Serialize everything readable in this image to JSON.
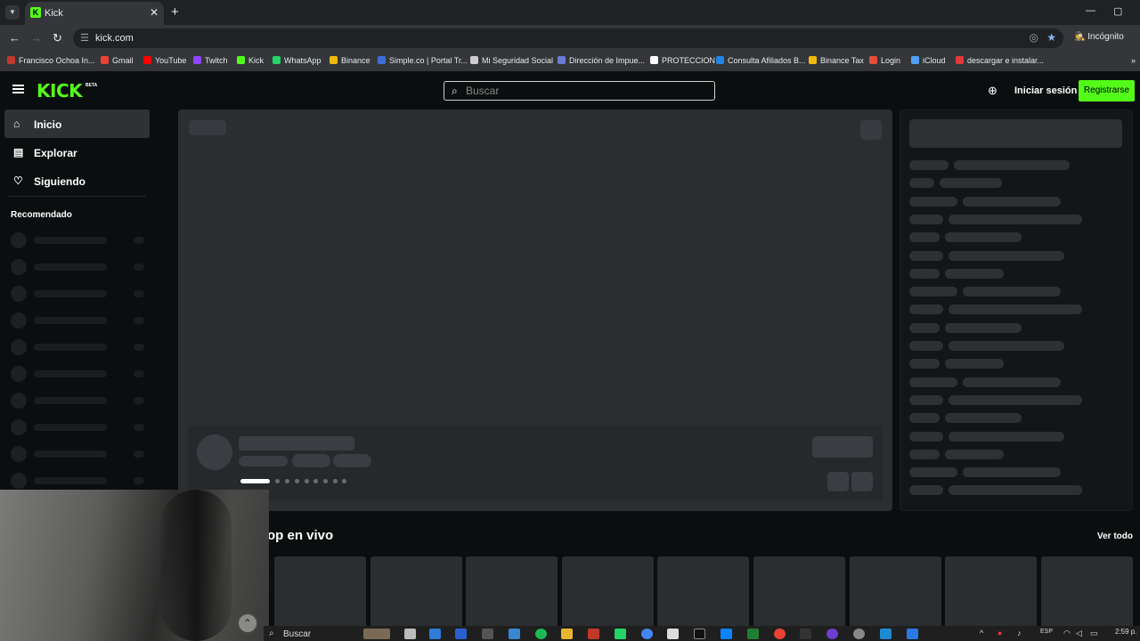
{
  "browser": {
    "tab_title": "Kick",
    "url": "kick.com",
    "incognito_label": "Incógnito",
    "bookmarks": [
      {
        "label": "Francisco Ochoa In...",
        "color": "#c0392b"
      },
      {
        "label": "Gmail",
        "color": "#ea4335"
      },
      {
        "label": "YouTube",
        "color": "#ff0000"
      },
      {
        "label": "Twitch",
        "color": "#9146ff"
      },
      {
        "label": "Kick",
        "color": "#53fc18"
      },
      {
        "label": "WhatsApp",
        "color": "#25d366"
      },
      {
        "label": "Binance",
        "color": "#f0b90b"
      },
      {
        "label": "Simple.co | Portal Tr...",
        "color": "#3b6fd6"
      },
      {
        "label": "Mi Seguridad Social",
        "color": "#cccccc"
      },
      {
        "label": "Dirección de Impue...",
        "color": "#6a7bd8"
      },
      {
        "label": "PROTECCION",
        "color": "#ffffff"
      },
      {
        "label": "Consulta Afiliados B...",
        "color": "#1e88e5"
      },
      {
        "label": "Binance Tax",
        "color": "#f0b90b"
      },
      {
        "label": "Login",
        "color": "#e74c3c"
      },
      {
        "label": "iCloud",
        "color": "#4fa3f7"
      },
      {
        "label": "descargar e instalar...",
        "color": "#e53935"
      }
    ]
  },
  "header": {
    "logo": "KICK",
    "logo_badge": "BETA",
    "search_placeholder": "Buscar",
    "login_label": "Iniciar sesión",
    "register_label": "Registrarse"
  },
  "sidebar": {
    "items": [
      {
        "label": "Inicio",
        "icon": "home-icon"
      },
      {
        "label": "Explorar",
        "icon": "browse-icon"
      },
      {
        "label": "Siguiendo",
        "icon": "heart-icon"
      }
    ],
    "recommended_title": "Recomendado"
  },
  "main": {
    "section_title": "op en vivo",
    "see_all_label": "Ver todo"
  },
  "taskbar": {
    "search_label": "Buscar",
    "language": "ESP",
    "time": "2:59 p."
  },
  "colors": {
    "brand": "#53fc18",
    "background": "#0b0e0f",
    "skeleton": "#2b2e31"
  }
}
